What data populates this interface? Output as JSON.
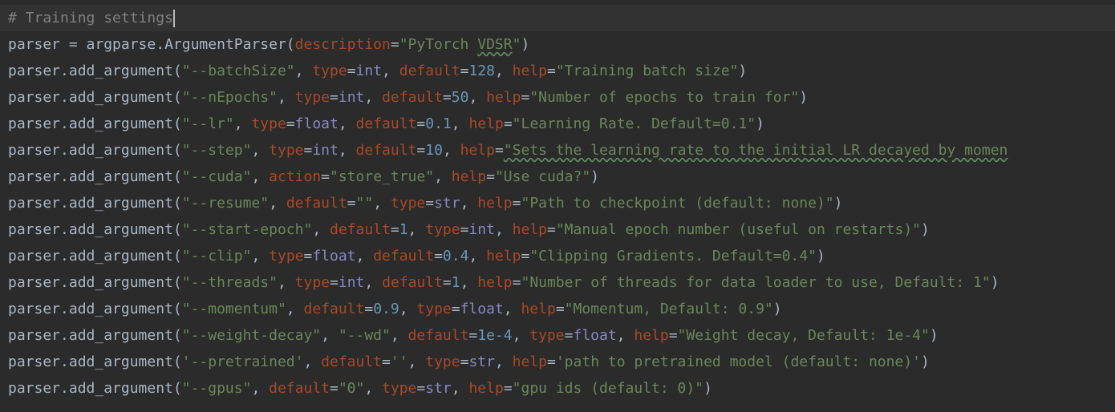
{
  "editor": {
    "comment": "# Training settings",
    "parser_line": {
      "lhs": "parser = argparse.ArgumentParser(",
      "kw": "description",
      "eq": "=",
      "str_q1": "\"PyTorch ",
      "str_vdsr": "VDSR",
      "str_q2": "\"",
      "close": ")"
    },
    "call": "parser.add_argument(",
    "lines": [
      [
        [
          "s",
          "\"--batchSize\""
        ],
        [
          "p",
          ", "
        ],
        [
          "k",
          "type"
        ],
        [
          "p",
          "="
        ],
        [
          "b",
          "int"
        ],
        [
          "p",
          ", "
        ],
        [
          "k",
          "default"
        ],
        [
          "p",
          "="
        ],
        [
          "n",
          "128"
        ],
        [
          "p",
          ", "
        ],
        [
          "k",
          "help"
        ],
        [
          "p",
          "="
        ],
        [
          "s",
          "\"Training batch size\""
        ],
        [
          "p",
          ")"
        ]
      ],
      [
        [
          "s",
          "\"--nEpochs\""
        ],
        [
          "p",
          ", "
        ],
        [
          "k",
          "type"
        ],
        [
          "p",
          "="
        ],
        [
          "b",
          "int"
        ],
        [
          "p",
          ", "
        ],
        [
          "k",
          "default"
        ],
        [
          "p",
          "="
        ],
        [
          "n",
          "50"
        ],
        [
          "p",
          ", "
        ],
        [
          "k",
          "help"
        ],
        [
          "p",
          "="
        ],
        [
          "s",
          "\"Number of epochs to train for\""
        ],
        [
          "p",
          ")"
        ]
      ],
      [
        [
          "s",
          "\"--lr\""
        ],
        [
          "p",
          ", "
        ],
        [
          "k",
          "type"
        ],
        [
          "p",
          "="
        ],
        [
          "b",
          "float"
        ],
        [
          "p",
          ", "
        ],
        [
          "k",
          "default"
        ],
        [
          "p",
          "="
        ],
        [
          "n",
          "0.1"
        ],
        [
          "p",
          ", "
        ],
        [
          "k",
          "help"
        ],
        [
          "p",
          "="
        ],
        [
          "s",
          "\"Learning Rate. Default=0.1\""
        ],
        [
          "p",
          ")"
        ]
      ],
      [
        [
          "s",
          "\"--step\""
        ],
        [
          "p",
          ", "
        ],
        [
          "k",
          "type"
        ],
        [
          "p",
          "="
        ],
        [
          "b",
          "int"
        ],
        [
          "p",
          ", "
        ],
        [
          "k",
          "default"
        ],
        [
          "p",
          "="
        ],
        [
          "n",
          "10"
        ],
        [
          "p",
          ", "
        ],
        [
          "k",
          "help"
        ],
        [
          "p",
          "="
        ],
        [
          "w",
          "\"Sets the learning rate to the initial LR decayed by momen"
        ]
      ],
      [
        [
          "s",
          "\"--cuda\""
        ],
        [
          "p",
          ", "
        ],
        [
          "k",
          "action"
        ],
        [
          "p",
          "="
        ],
        [
          "s",
          "\"store_true\""
        ],
        [
          "p",
          ", "
        ],
        [
          "k",
          "help"
        ],
        [
          "p",
          "="
        ],
        [
          "s",
          "\"Use cuda?\""
        ],
        [
          "p",
          ")"
        ]
      ],
      [
        [
          "s",
          "\"--resume\""
        ],
        [
          "p",
          ", "
        ],
        [
          "k",
          "default"
        ],
        [
          "p",
          "="
        ],
        [
          "s",
          "\"\""
        ],
        [
          "p",
          ", "
        ],
        [
          "k",
          "type"
        ],
        [
          "p",
          "="
        ],
        [
          "b",
          "str"
        ],
        [
          "p",
          ", "
        ],
        [
          "k",
          "help"
        ],
        [
          "p",
          "="
        ],
        [
          "s",
          "\"Path to checkpoint (default: none)\""
        ],
        [
          "p",
          ")"
        ]
      ],
      [
        [
          "s",
          "\"--start-epoch\""
        ],
        [
          "p",
          ", "
        ],
        [
          "k",
          "default"
        ],
        [
          "p",
          "="
        ],
        [
          "n",
          "1"
        ],
        [
          "p",
          ", "
        ],
        [
          "k",
          "type"
        ],
        [
          "p",
          "="
        ],
        [
          "b",
          "int"
        ],
        [
          "p",
          ", "
        ],
        [
          "k",
          "help"
        ],
        [
          "p",
          "="
        ],
        [
          "s",
          "\"Manual epoch number (useful on restarts)\""
        ],
        [
          "p",
          ")"
        ]
      ],
      [
        [
          "s",
          "\"--clip\""
        ],
        [
          "p",
          ", "
        ],
        [
          "k",
          "type"
        ],
        [
          "p",
          "="
        ],
        [
          "b",
          "float"
        ],
        [
          "p",
          ", "
        ],
        [
          "k",
          "default"
        ],
        [
          "p",
          "="
        ],
        [
          "n",
          "0.4"
        ],
        [
          "p",
          ", "
        ],
        [
          "k",
          "help"
        ],
        [
          "p",
          "="
        ],
        [
          "s",
          "\"Clipping Gradients. Default=0.4\""
        ],
        [
          "p",
          ")"
        ]
      ],
      [
        [
          "s",
          "\"--threads\""
        ],
        [
          "p",
          ", "
        ],
        [
          "k",
          "type"
        ],
        [
          "p",
          "="
        ],
        [
          "b",
          "int"
        ],
        [
          "p",
          ", "
        ],
        [
          "k",
          "default"
        ],
        [
          "p",
          "="
        ],
        [
          "n",
          "1"
        ],
        [
          "p",
          ", "
        ],
        [
          "k",
          "help"
        ],
        [
          "p",
          "="
        ],
        [
          "s",
          "\"Number of threads for data loader to use, Default: 1\""
        ],
        [
          "p",
          ")"
        ]
      ],
      [
        [
          "s",
          "\"--momentum\""
        ],
        [
          "p",
          ", "
        ],
        [
          "k",
          "default"
        ],
        [
          "p",
          "="
        ],
        [
          "n",
          "0.9"
        ],
        [
          "p",
          ", "
        ],
        [
          "k",
          "type"
        ],
        [
          "p",
          "="
        ],
        [
          "b",
          "float"
        ],
        [
          "p",
          ", "
        ],
        [
          "k",
          "help"
        ],
        [
          "p",
          "="
        ],
        [
          "s",
          "\"Momentum, Default: 0.9\""
        ],
        [
          "p",
          ")"
        ]
      ],
      [
        [
          "s",
          "\"--weight-decay\""
        ],
        [
          "p",
          ", "
        ],
        [
          "s",
          "\"--wd\""
        ],
        [
          "p",
          ", "
        ],
        [
          "k",
          "default"
        ],
        [
          "p",
          "="
        ],
        [
          "n",
          "1e-4"
        ],
        [
          "p",
          ", "
        ],
        [
          "k",
          "type"
        ],
        [
          "p",
          "="
        ],
        [
          "b",
          "float"
        ],
        [
          "p",
          ", "
        ],
        [
          "k",
          "help"
        ],
        [
          "p",
          "="
        ],
        [
          "s",
          "\"Weight decay, Default: 1e-4\""
        ],
        [
          "p",
          ")"
        ]
      ],
      [
        [
          "s",
          "'--pretrained'"
        ],
        [
          "p",
          ", "
        ],
        [
          "k",
          "default"
        ],
        [
          "p",
          "="
        ],
        [
          "s",
          "''"
        ],
        [
          "p",
          ", "
        ],
        [
          "k",
          "type"
        ],
        [
          "p",
          "="
        ],
        [
          "b",
          "str"
        ],
        [
          "p",
          ", "
        ],
        [
          "k",
          "help"
        ],
        [
          "p",
          "="
        ],
        [
          "s",
          "'path to pretrained model (default: none)'"
        ],
        [
          "p",
          ")"
        ]
      ],
      [
        [
          "s",
          "\"--gpus\""
        ],
        [
          "p",
          ", "
        ],
        [
          "k",
          "default"
        ],
        [
          "p",
          "="
        ],
        [
          "s",
          "\"0\""
        ],
        [
          "p",
          ", "
        ],
        [
          "k",
          "type"
        ],
        [
          "p",
          "="
        ],
        [
          "b",
          "str"
        ],
        [
          "p",
          ", "
        ],
        [
          "k",
          "help"
        ],
        [
          "p",
          "="
        ],
        [
          "s",
          "\"gpu ids (default: 0)\""
        ],
        [
          "p",
          ")"
        ]
      ]
    ]
  }
}
